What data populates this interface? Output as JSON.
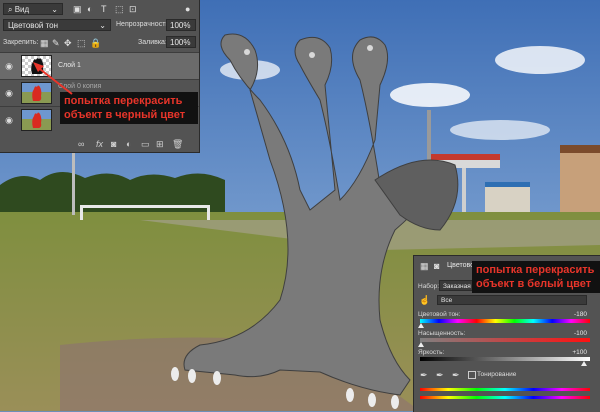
{
  "layers_panel": {
    "kind_filter": "Вид",
    "blend_mode": "Цветовой тон",
    "opacity_label": "Непрозрачность:",
    "opacity_value": "100%",
    "lock_label": "Закрепить:",
    "fill_label": "Заливка:",
    "fill_value": "100%",
    "layers": [
      {
        "name": "Слой 1",
        "selected": true
      },
      {
        "name": "Слой 0 копия",
        "selected": false
      },
      {
        "name": "",
        "selected": false
      }
    ],
    "callout": "попытка перекрасить объект в черный цвет",
    "fx_label": "fx"
  },
  "properties_panel": {
    "title": "Цветовой",
    "preset_label": "Набор:",
    "preset_value": "Заказная",
    "channel_value": "Все",
    "hue_label": "Цветовой тон:",
    "hue_value": "-180",
    "saturation_label": "Насыщенность:",
    "saturation_value": "-100",
    "lightness_label": "Яркость:",
    "lightness_value": "+100",
    "colorize_label": "Тонирование",
    "callout": "попытка перекрасить объект в белый цвет"
  },
  "colors": {
    "panel_bg": "#535353",
    "callout_text": "#e8352a",
    "arrow": "#e8352a"
  }
}
